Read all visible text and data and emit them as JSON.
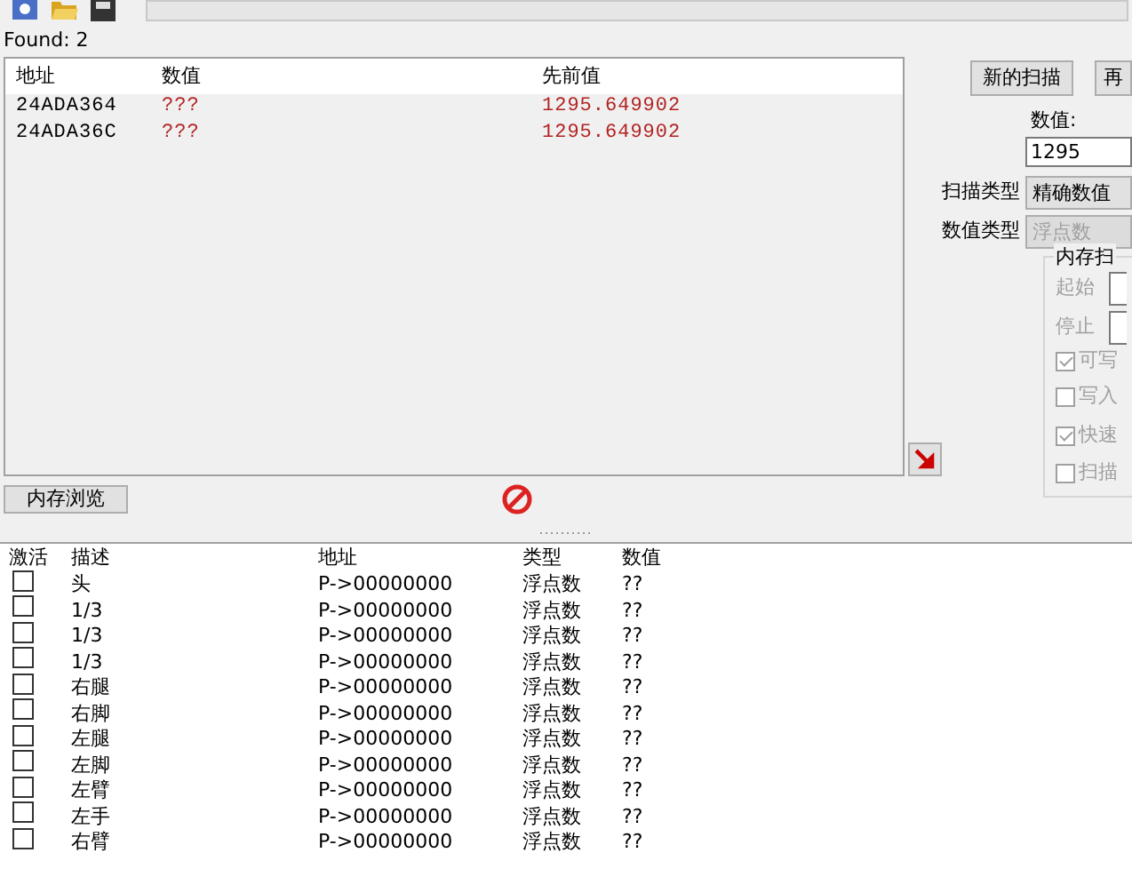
{
  "progress": {
    "level": 0
  },
  "found_label": "Found: 2",
  "results": {
    "columns": [
      "地址",
      "数值",
      "先前值"
    ],
    "rows": [
      {
        "address": "24ADA364",
        "value": "???",
        "previous": "1295.649902"
      },
      {
        "address": "24ADA36C",
        "value": "???",
        "previous": "1295.649902"
      }
    ]
  },
  "scan_buttons": [
    "新的扫描",
    "再"
  ],
  "value_label": "数值:",
  "value_input": "1295",
  "scan_type": {
    "label": "扫描类型",
    "value": "精确数值",
    "disabled": false
  },
  "value_type": {
    "label": "数值类型",
    "value": "浮点数",
    "disabled": true
  },
  "memory_scan": {
    "title": "内存扫",
    "disabled": true,
    "fields": [
      {
        "label": "起始"
      },
      {
        "label": "停止"
      }
    ],
    "options": [
      {
        "label": "可写",
        "checked": true
      },
      {
        "label": "写入",
        "checked": false
      },
      {
        "label": "快速",
        "checked": true
      },
      {
        "label": "扫描",
        "checked": false
      }
    ]
  },
  "memory_view_button": "内存浏览",
  "address_list": {
    "columns": [
      "激活",
      "描述",
      "地址",
      "类型",
      "数值"
    ],
    "rows": [
      {
        "active": false,
        "description": "头",
        "address": "P->00000000",
        "type": "浮点数",
        "value": "??"
      },
      {
        "active": false,
        "description": "1/3",
        "address": "P->00000000",
        "type": "浮点数",
        "value": "??"
      },
      {
        "active": false,
        "description": "1/3",
        "address": "P->00000000",
        "type": "浮点数",
        "value": "??"
      },
      {
        "active": false,
        "description": "1/3",
        "address": "P->00000000",
        "type": "浮点数",
        "value": "??"
      },
      {
        "active": false,
        "description": "右腿",
        "address": "P->00000000",
        "type": "浮点数",
        "value": "??"
      },
      {
        "active": false,
        "description": "右脚",
        "address": "P->00000000",
        "type": "浮点数",
        "value": "??"
      },
      {
        "active": false,
        "description": "左腿",
        "address": "P->00000000",
        "type": "浮点数",
        "value": "??"
      },
      {
        "active": false,
        "description": "左脚",
        "address": "P->00000000",
        "type": "浮点数",
        "value": "??"
      },
      {
        "active": false,
        "description": "左臂",
        "address": "P->00000000",
        "type": "浮点数",
        "value": "??"
      },
      {
        "active": false,
        "description": "左手",
        "address": "P->00000000",
        "type": "浮点数",
        "value": "??"
      },
      {
        "active": false,
        "description": "右臂",
        "address": "P->00000000",
        "type": "浮点数",
        "value": "??"
      }
    ]
  }
}
